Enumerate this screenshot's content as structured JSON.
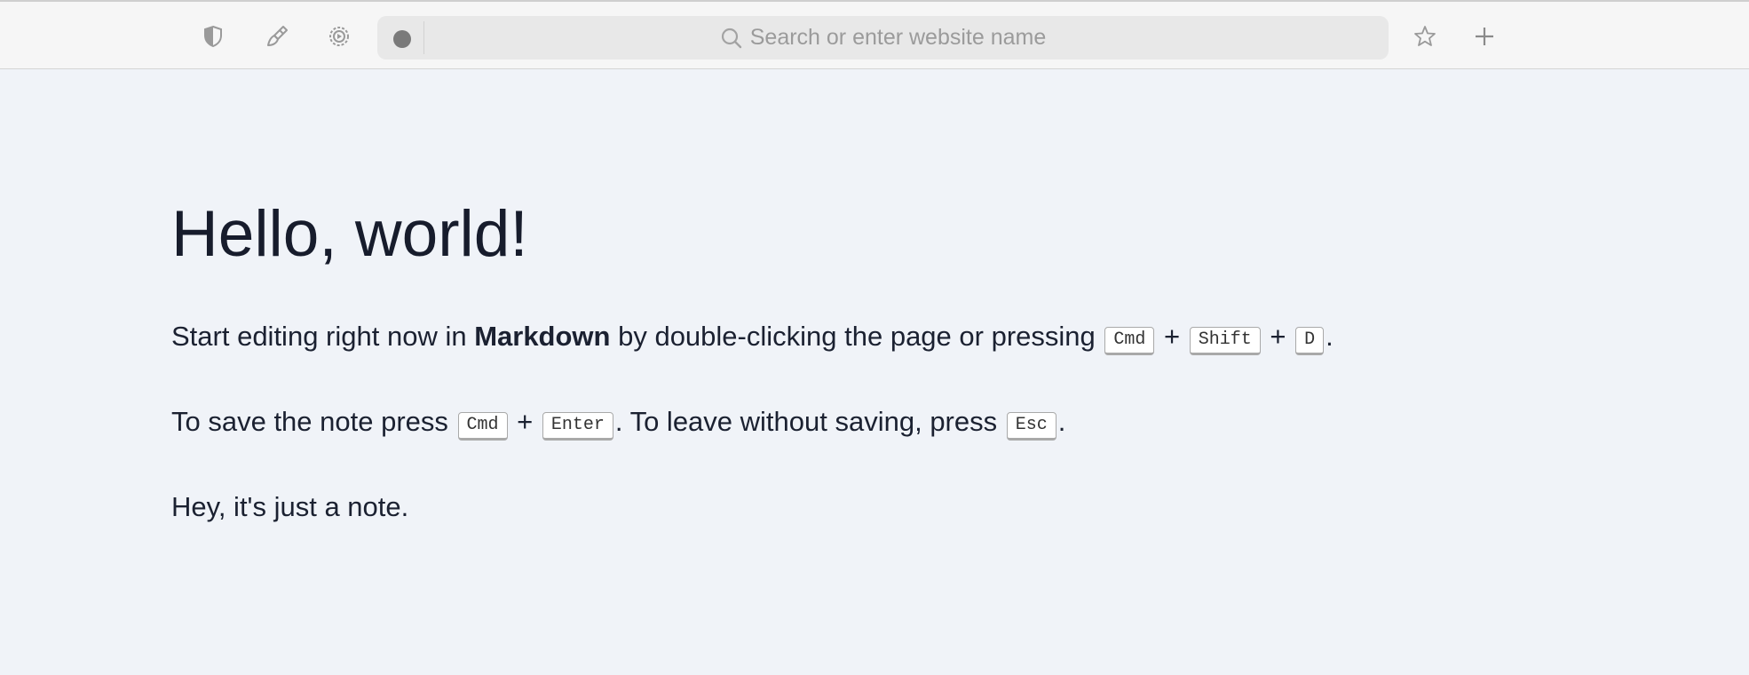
{
  "toolbar": {
    "icons": [
      "shield-icon",
      "brush-icon",
      "settings-badge-icon"
    ],
    "address_bar": {
      "placeholder": "Search or enter website name",
      "indicator": "record-dot-icon"
    },
    "right_icons": [
      "star-icon",
      "plus-icon"
    ]
  },
  "page": {
    "heading": "Hello, world!",
    "paragraph1": {
      "prefix": "Start editing right now in ",
      "bold": "Markdown",
      "middle": " by double-clicking the page or pressing ",
      "key1": "Cmd",
      "plus1": " + ",
      "key2": "Shift",
      "plus2": " + ",
      "key3": "D",
      "suffix": "."
    },
    "paragraph2": {
      "prefix": "To save the note press ",
      "key1": "Cmd",
      "plus1": " + ",
      "key2": "Enter",
      "middle": ". To leave without saving, press ",
      "key3": "Esc",
      "suffix": "."
    },
    "paragraph3": "Hey, it's just a note."
  },
  "colors": {
    "page_background": "#f0f3f8",
    "toolbar_background": "#f6f6f6",
    "text": "#1b2131",
    "icon": "#9a9a9a"
  }
}
